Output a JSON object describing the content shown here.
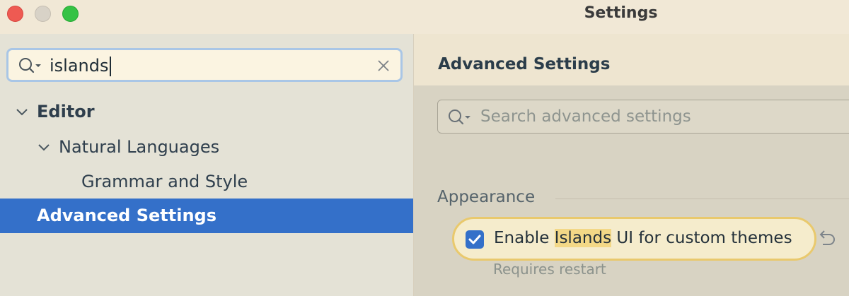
{
  "window": {
    "title": "Settings"
  },
  "sidebar": {
    "search": {
      "value": "islands",
      "icon": "search-icon",
      "clear_icon": "clear-icon"
    },
    "tree": [
      {
        "label": "Editor",
        "expanded": true,
        "bold": true
      },
      {
        "label": "Natural Languages",
        "expanded": true,
        "bold": false
      },
      {
        "label": "Grammar and Style",
        "bold": false
      },
      {
        "label": "Advanced Settings",
        "bold": true,
        "selected": true
      }
    ]
  },
  "main": {
    "title": "Advanced Settings",
    "search_placeholder": "Search advanced settings",
    "section": "Appearance",
    "option": {
      "label_before": "Enable ",
      "label_highlight": "Islands",
      "label_after": " UI for custom themes",
      "checked": true,
      "hint": "Requires restart",
      "reset_icon": "undo-icon"
    }
  },
  "colors": {
    "selection": "#3470c9",
    "highlight": "#f3d886",
    "option_border": "#e9c96d"
  }
}
